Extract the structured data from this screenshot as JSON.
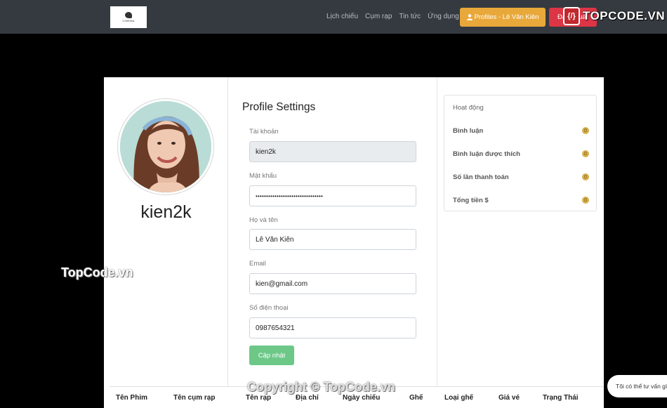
{
  "brand": {
    "logo_text": "CINEMA"
  },
  "nav": {
    "links": [
      "Lịch chiếu",
      "Cụm rạp",
      "Tin tức",
      "Ứng dụng"
    ],
    "profile_button": "Profiles - Lê Văn Kiên",
    "logout_button": "Đăng xuất"
  },
  "watermarks": {
    "header": "TOPCODE.VN",
    "middle": "TopCode.vn",
    "footer": "Copyright © TopCode.vn"
  },
  "profile": {
    "username": "kien2k"
  },
  "form": {
    "title": "Profile Settings",
    "fields": [
      {
        "label": "Tài khoản",
        "value": "kien2k"
      },
      {
        "label": "Mật khẩu",
        "value": "••••••••••••••••••••••••••••••••"
      },
      {
        "label": "Họ và tên",
        "value": "Lê Văn Kiên"
      },
      {
        "label": "Email",
        "value": "kien@gmail.com"
      },
      {
        "label": "Số điện thoại",
        "value": "0987654321"
      }
    ],
    "submit": "Cập nhật"
  },
  "activity": {
    "title": "Hoạt động",
    "items": [
      {
        "label": "Bình luận",
        "value": "0"
      },
      {
        "label": "Bình luận được thích",
        "value": "0"
      },
      {
        "label": "Số lần thanh toán",
        "value": "0"
      },
      {
        "label": "Tổng tiền $",
        "value": "0"
      }
    ]
  },
  "history_table": {
    "columns": [
      "Tên Phim",
      "Tên cụm rạp",
      "Tên rạp",
      "Địa chỉ",
      "Ngày chiếu",
      "Ghế",
      "Loại ghế",
      "Giá vé",
      "Trạng Thái"
    ]
  },
  "chat": {
    "text": "Tôi có thể tư vấn gì"
  },
  "colors": {
    "navbar": "#353a40",
    "profile_button": "#e9a83a",
    "logout_button": "#dc3545",
    "update_button": "#6dc888"
  }
}
